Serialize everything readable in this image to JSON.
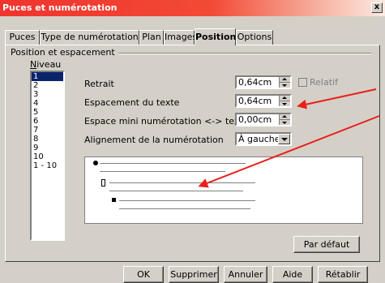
{
  "window": {
    "title": "Puces et numérotation",
    "close_label": "x"
  },
  "tabs": [
    {
      "label": "Puces"
    },
    {
      "label": "Type de numérotation"
    },
    {
      "label": "Plan"
    },
    {
      "label": "Images"
    },
    {
      "label": "Position",
      "active": true
    },
    {
      "label": "Options"
    }
  ],
  "section": {
    "title": "Position et espacement",
    "niveau_label": "Niveau"
  },
  "levels": [
    "1",
    "2",
    "3",
    "4",
    "5",
    "6",
    "7",
    "8",
    "9",
    "10",
    "1 - 10"
  ],
  "selected_level": "1",
  "fields": {
    "retrait": {
      "label": "Retrait",
      "value": "0,64cm"
    },
    "espacement": {
      "label": "Espacement du texte",
      "value": "0,64cm"
    },
    "espace_mini": {
      "label": "Espace mini numérotation <-> texte",
      "value": "0,00cm"
    },
    "alignement": {
      "label": "Alignement de la numérotation",
      "value": "À gauche"
    },
    "relatif": {
      "label": "Relatif",
      "checked": false
    }
  },
  "buttons": {
    "par_defaut": "Par défaut",
    "ok": "OK",
    "supprimer": "Supprimer",
    "annuler": "Annuler",
    "aide": "Aide",
    "retablir": "Rétablir"
  },
  "colors": {
    "titlebar": "#f0332e",
    "annotation_arrow": "#e8201a",
    "selection": "#0a246a"
  }
}
